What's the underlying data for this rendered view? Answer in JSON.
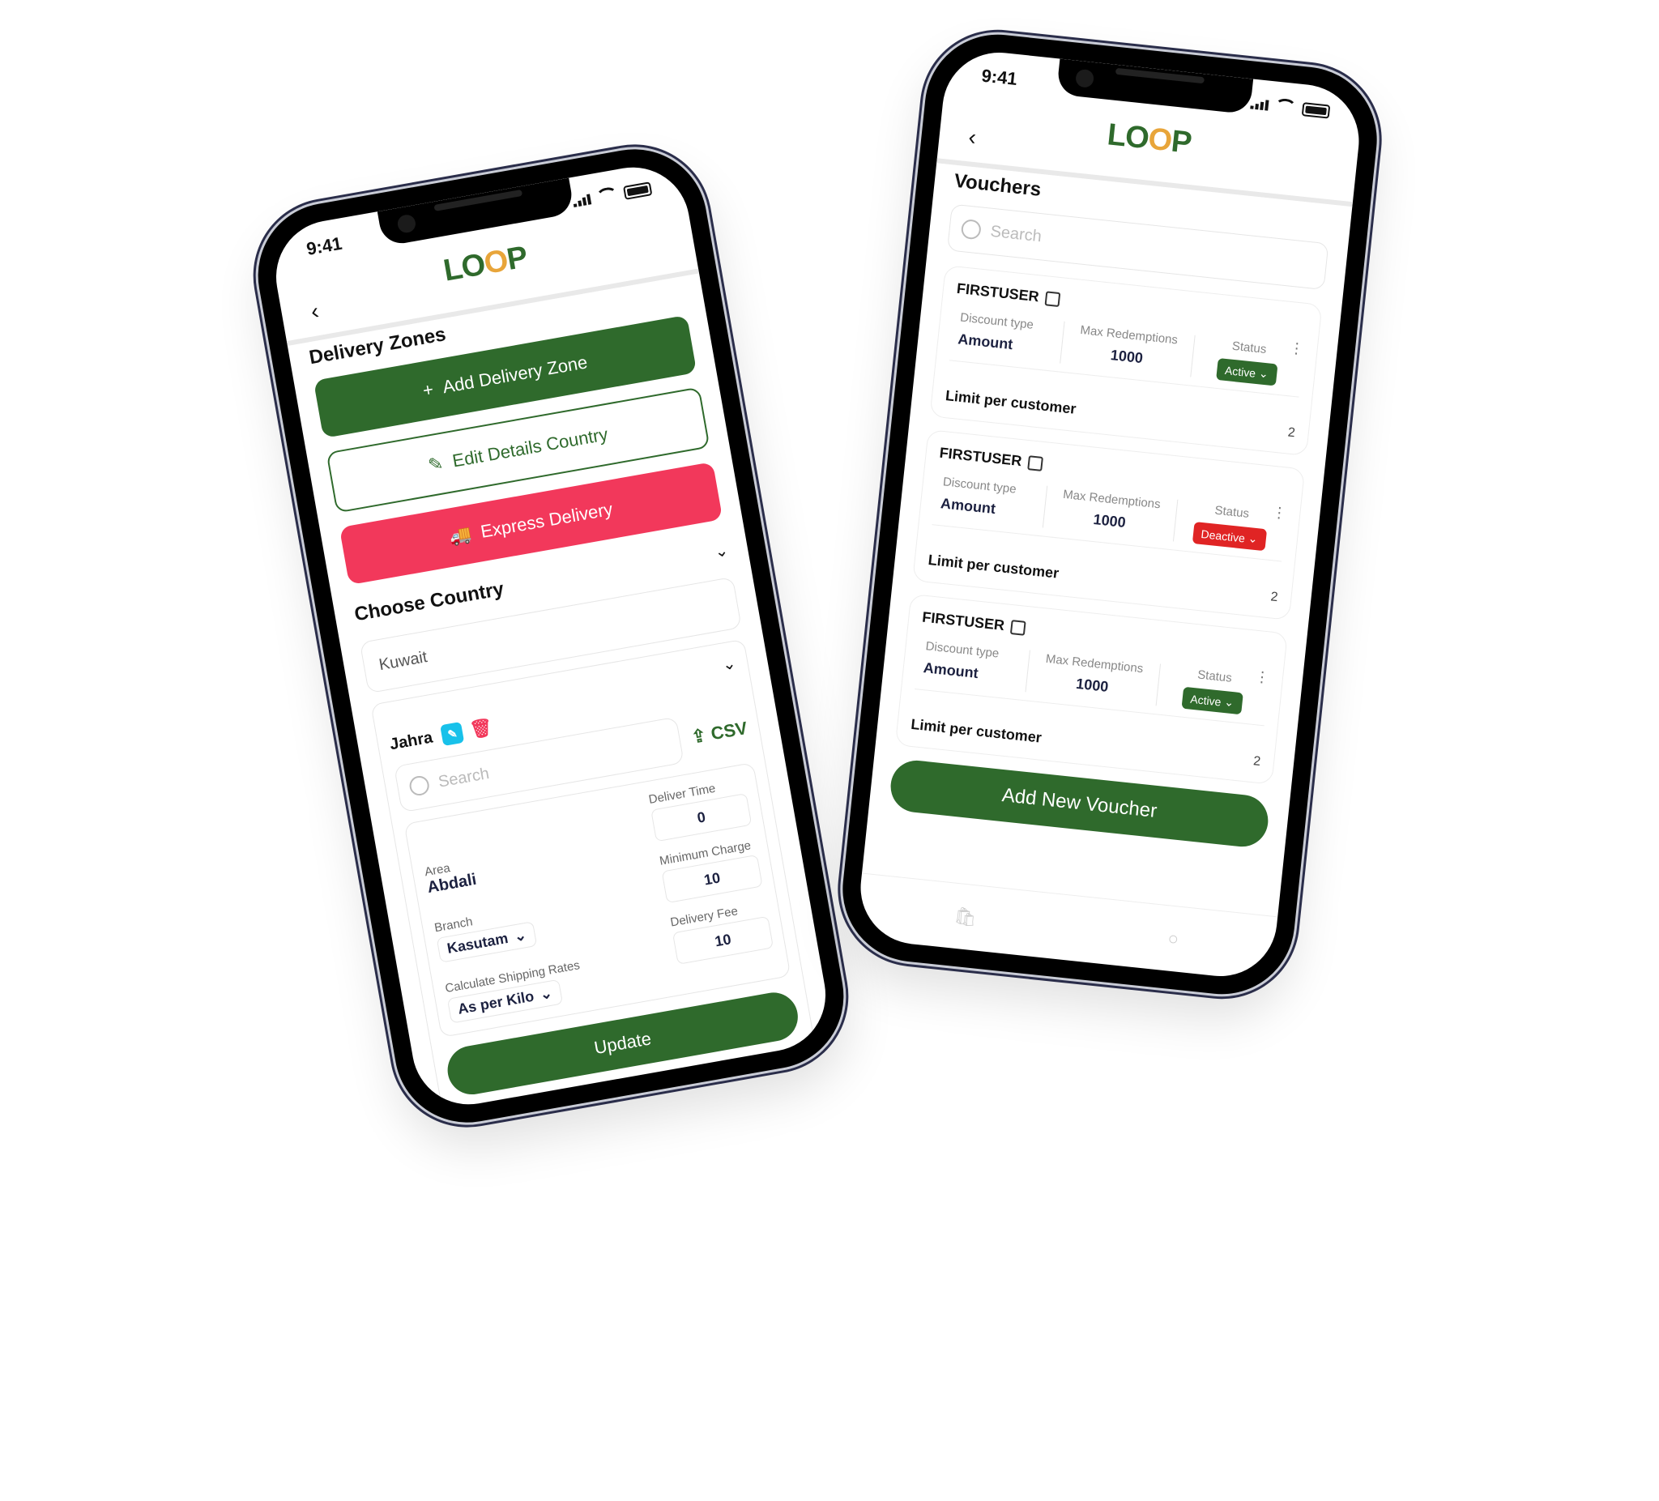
{
  "status_bar": {
    "time": "9:41"
  },
  "brand": {
    "logo_text_1": "LO",
    "logo_text_2": "O",
    "logo_text_3": "P",
    "primary_color": "#2f6a2c",
    "accent_color": "#e8a53a",
    "danger_color": "#f2385b",
    "info_color": "#18c1ea"
  },
  "left_phone": {
    "page_title": "Delivery Zones",
    "add_zone_button": "Add Delivery Zone",
    "edit_country_button": "Edit Details Country",
    "express_button": "Express Delivery",
    "choose_country_label": "Choose Country",
    "country_select_value": "Kuwait",
    "zone": {
      "name": "Jahra",
      "search_placeholder": "Search",
      "csv_label": "CSV",
      "area_label": "Area",
      "area_value": "Abdali",
      "branch_label": "Branch",
      "branch_value": "Kasutam",
      "shipping_label": "Calculate Shipping  Rates",
      "shipping_value": "As per Kilo",
      "deliver_time_label": "Deliver Time",
      "deliver_time_value": "0",
      "min_charge_label": "Minimum Charge",
      "min_charge_value": "10",
      "delivery_fee_label": "Delivery Fee",
      "delivery_fee_value": "10",
      "update_button": "Update",
      "delete_button": "Delete"
    }
  },
  "right_phone": {
    "page_title": "Vouchers",
    "search_placeholder": "Search",
    "labels": {
      "discount_type": "Discount type",
      "max_redemptions": "Max Redemptions",
      "status": "Status",
      "limit_per_customer": "Limit per customer"
    },
    "vouchers": [
      {
        "code": "FIRSTUSER",
        "discount_type": "Amount",
        "max_redemptions": "1000",
        "status": "Active",
        "status_color": "#2f6a2c",
        "limit": "2"
      },
      {
        "code": "FIRSTUSER",
        "discount_type": "Amount",
        "max_redemptions": "1000",
        "status": "Deactive",
        "status_color": "#e02424",
        "limit": "2"
      },
      {
        "code": "FIRSTUSER",
        "discount_type": "Amount",
        "max_redemptions": "1000",
        "status": "Active",
        "status_color": "#2f6a2c",
        "limit": "2"
      }
    ],
    "add_button": "Add New Voucher"
  }
}
